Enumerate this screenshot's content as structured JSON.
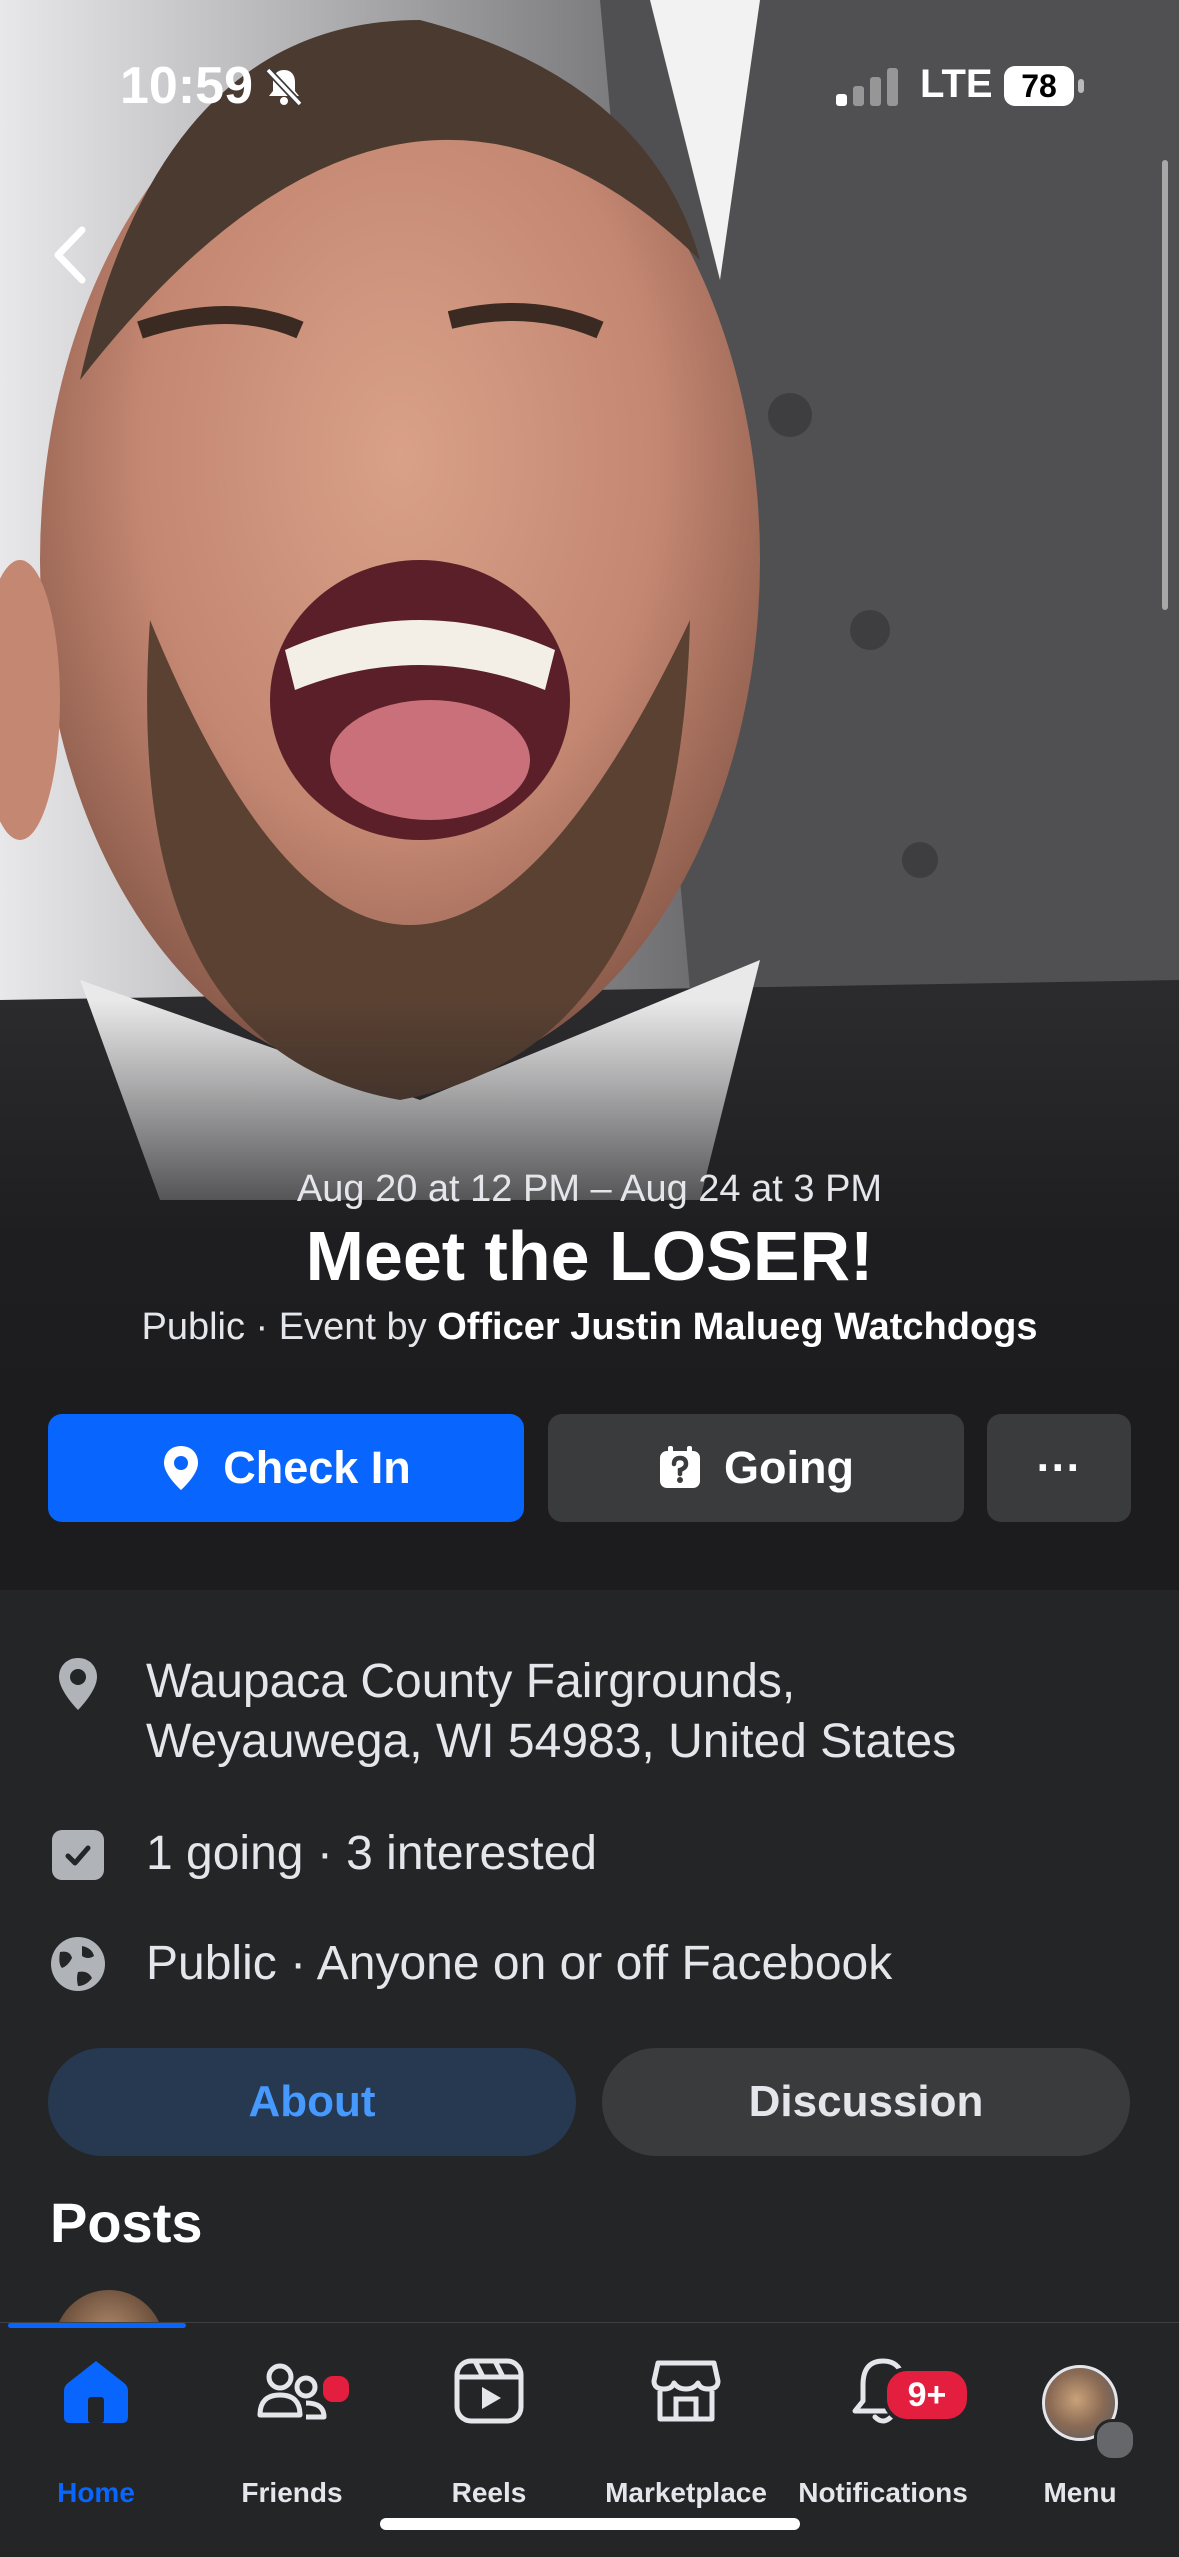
{
  "status_bar": {
    "time": "10:59",
    "carrier": "LTE",
    "battery": "78"
  },
  "event": {
    "date_range": "Aug 20 at 12 PM – Aug 24 at 3 PM",
    "title": "Meet the LOSER!",
    "privacy": "Public",
    "host_prefix": " · Event by ",
    "host_name": "Officer Justin Malueg Watchdogs"
  },
  "actions": {
    "check_in": "Check In",
    "going": "Going",
    "more": "···"
  },
  "details": {
    "location_line1": "Waupaca County Fairgrounds,",
    "location_line2": "Weyauwega, WI 54983, United States",
    "attendance": "1 going · 3 interested",
    "visibility": "Public · Anyone on or off Facebook"
  },
  "tabs": {
    "about": "About",
    "discussion": "Discussion"
  },
  "posts": {
    "heading": "Posts"
  },
  "bottom_nav": {
    "home": "Home",
    "friends": "Friends",
    "reels": "Reels",
    "marketplace": "Marketplace",
    "notifications": "Notifications",
    "notifications_badge": "9+",
    "menu": "Menu"
  },
  "colors": {
    "accent": "#0866ff",
    "background": "#242526",
    "button_secondary": "#3a3b3c",
    "tab_active_bg": "#263951",
    "badge": "#e41e3f"
  },
  "icons": {
    "back": "chevron-left-icon",
    "check_in": "location-pin-icon",
    "going": "calendar-question-icon",
    "location": "location-pin-icon",
    "attendance": "calendar-check-icon",
    "visibility": "globe-icon"
  }
}
